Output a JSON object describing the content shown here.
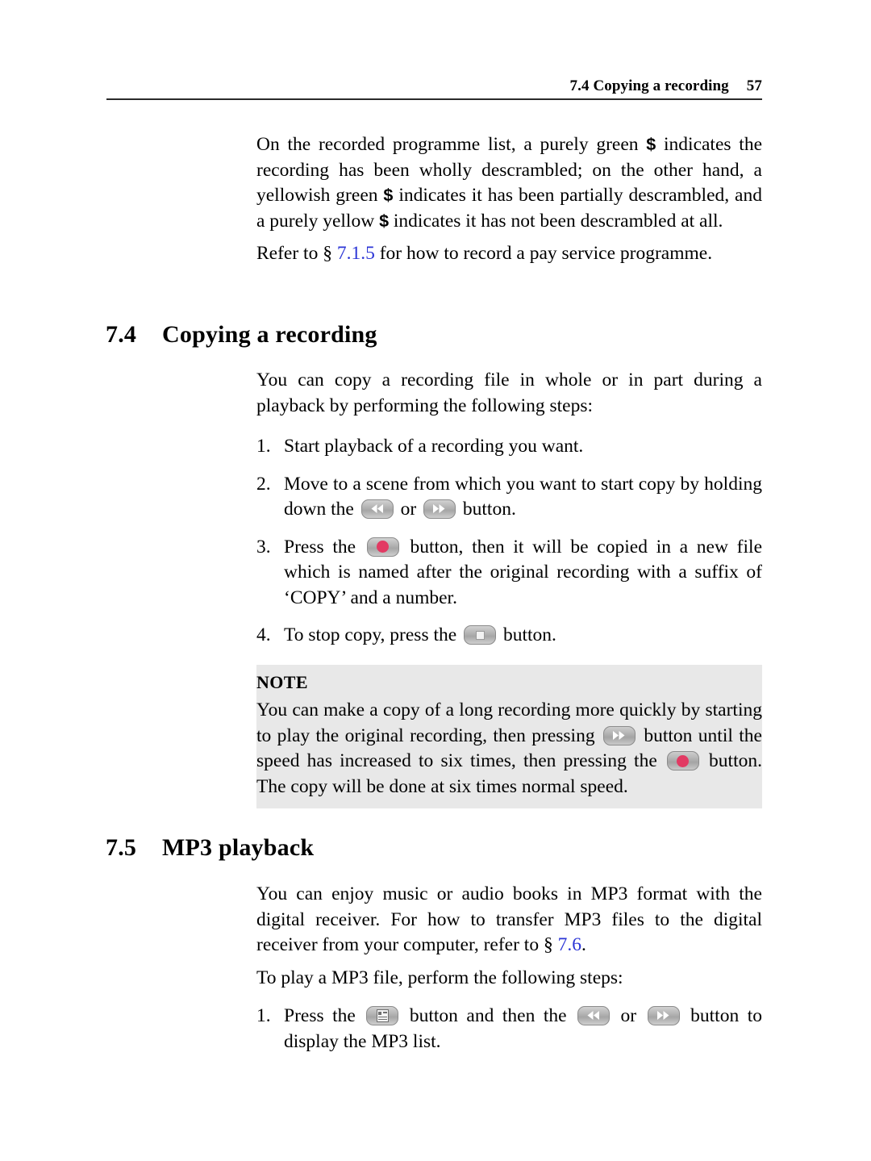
{
  "header": {
    "title": "7.4 Copying a recording",
    "page_number": "57"
  },
  "intro": {
    "para1_a": "On the recorded programme list, a purely green ",
    "para1_b": " indicates the recording has been wholly descrambled; on the other hand, a yellowish green ",
    "para1_c": " indicates it has been partially descrambled, and a purely yellow ",
    "para1_d": " indicates it has not been descrambled at all.",
    "dollar_symbol": "$",
    "para2_a": "Refer to § ",
    "para2_link": "7.1.5",
    "para2_b": " for how to record a pay service programme."
  },
  "section_74": {
    "number": "7.4",
    "title": "Copying a recording",
    "lead": "You can copy a recording file in whole or in part during a playback by performing the following steps:",
    "steps": [
      {
        "marker": "1.",
        "text_a": "Start playback of a recording you want.",
        "text_b": "",
        "text_c": "",
        "icon1": "",
        "icon2": ""
      },
      {
        "marker": "2.",
        "text_a": "Move to a scene from which you want to start copy by holding down the ",
        "text_b": " or ",
        "text_c": " button.",
        "icon1": "rewind-key",
        "icon2": "fast-forward-key"
      },
      {
        "marker": "3.",
        "text_a": "Press the ",
        "text_b": " button, then it will be copied in a new file which is named after the original recording with a suffix of ‘COPY’ and a number.",
        "text_c": "",
        "icon1": "record-key",
        "icon2": ""
      },
      {
        "marker": "4.",
        "text_a": "To stop copy, press the ",
        "text_b": " button.",
        "text_c": "",
        "icon1": "stop-key",
        "icon2": ""
      }
    ]
  },
  "note": {
    "title": "NOTE",
    "text_a": "You can make a copy of a long recording more quickly by starting to play the original recording, then pressing ",
    "text_b": " button until the speed has increased to six times, then pressing the ",
    "text_c": " button. The copy will be done at six times normal speed.",
    "icon1": "fast-forward-key",
    "icon2": "record-key"
  },
  "section_75": {
    "number": "7.5",
    "title": "MP3 playback",
    "para1_a": "You can enjoy music or audio books in MP3 format with the digital receiver. For how to transfer MP3 files to the digital receiver from your computer, refer to § ",
    "para1_link": "7.6",
    "para1_b": ".",
    "para2": "To play a MP3 file, perform the following steps:",
    "steps": [
      {
        "marker": "1.",
        "text_a": "Press the ",
        "text_b": " button and then the ",
        "text_c": " or ",
        "text_d": " button to display the MP3 list.",
        "icon1": "list-key",
        "icon2": "rewind-key",
        "icon3": "fast-forward-key"
      }
    ]
  },
  "colors": {
    "link": "#2b35d6",
    "note_background": "#e8e8e8",
    "record_dot": "#e23a63",
    "key_border": "#8b8b8b",
    "rule": "#2a2a2a"
  }
}
